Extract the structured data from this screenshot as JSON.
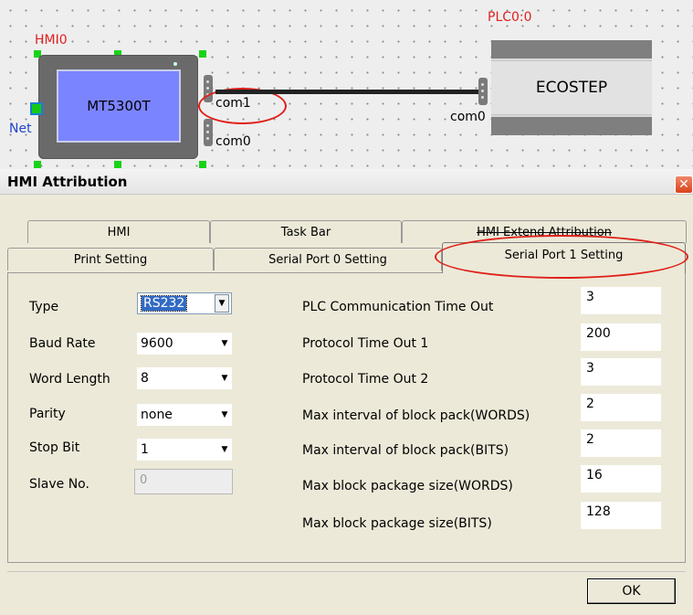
{
  "canvas": {
    "hmi_label": "HMI0",
    "hmi_model": "MT5300T",
    "net_label": "Net",
    "port_com1": "com1",
    "port_com0_hmi": "com0",
    "plc_label": "PLC0:0",
    "plc_model": "ECOSTEP",
    "port_com0_plc": "com0"
  },
  "dialog": {
    "title": "HMI Attribution",
    "close_icon": "close-icon",
    "tabs_row1": [
      "HMI",
      "Task Bar",
      "HMI Extend Attribution"
    ],
    "tabs_row2": [
      "Print Setting",
      "Serial Port 0 Setting",
      "Serial Port 1 Setting"
    ],
    "active_tab": "Serial Port 1 Setting",
    "left_fields": {
      "type": {
        "label": "Type",
        "value": "RS232"
      },
      "baud": {
        "label": "Baud Rate",
        "value": "9600"
      },
      "word": {
        "label": "Word Length",
        "value": "8"
      },
      "parity": {
        "label": "Parity",
        "value": "none"
      },
      "stop": {
        "label": "Stop Bit",
        "value": "1"
      },
      "slave": {
        "label": "Slave No.",
        "value": "0"
      }
    },
    "right_fields": [
      {
        "label": "PLC Communication Time Out",
        "value": "3"
      },
      {
        "label": "Protocol Time Out 1",
        "value": "200"
      },
      {
        "label": "Protocol Time Out 2",
        "value": "3"
      },
      {
        "label": "Max interval of block pack(WORDS)",
        "value": "2"
      },
      {
        "label": "Max interval of block pack(BITS)",
        "value": "2"
      },
      {
        "label": "Max block package size(WORDS)",
        "value": "16"
      },
      {
        "label": "Max block package size(BITS)",
        "value": "128"
      }
    ],
    "ok_label": "OK"
  },
  "colors": {
    "annotation_red": "#e0201a",
    "hmi_screen": "#7b84ff",
    "selection_handle": "#17d317",
    "dialog_bg": "#ece9d8"
  }
}
